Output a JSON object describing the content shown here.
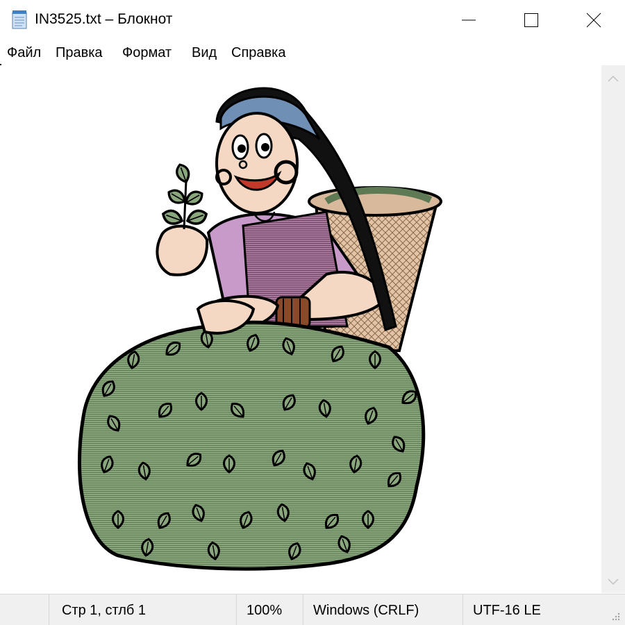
{
  "window": {
    "title": "IN3525.txt – Блокнот",
    "icon": "notepad-icon",
    "controls": [
      "minimize-icon",
      "maximize-icon",
      "close-icon"
    ]
  },
  "menu": {
    "file": "Файл",
    "edit": "Правка",
    "format": "Формат",
    "view": "Вид",
    "help": "Справка"
  },
  "editor": {
    "content_description_icon": "tea-picker-woman-clipart"
  },
  "status": {
    "position": "Стр 1, стлб 1",
    "zoom": "100%",
    "line_endings": "Windows (CRLF)",
    "encoding": "UTF-16 LE"
  },
  "colors": {
    "leaf_green": "#8aa67c",
    "sari_purple": "#c79ac9",
    "skin": "#f5d8c4",
    "basket": "#d9b99b",
    "outline": "#000000",
    "chrome_bg": "#f0f0f0"
  }
}
